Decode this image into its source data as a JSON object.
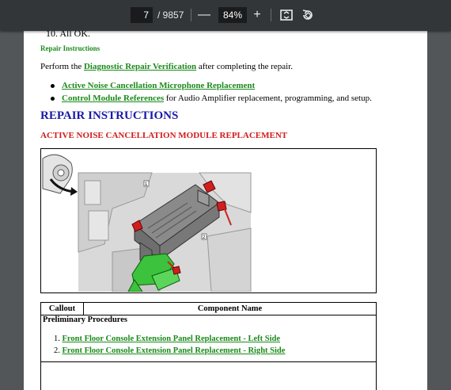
{
  "toolbar": {
    "page_current": "7",
    "page_total": "/ 9857",
    "zoom": "84%",
    "zoom_out": "—",
    "zoom_in": "+"
  },
  "doc": {
    "cut_line": "10. All OK.",
    "repair_heading": "Repair Instructions",
    "perform_pre": "Perform the ",
    "perform_link": "Diagnostic Repair Verification",
    "perform_post": " after completing the repair.",
    "bullets": [
      {
        "link": "Active Noise Cancellation Microphone Replacement",
        "rest": ""
      },
      {
        "link": "Control Module References",
        "rest": " for Audio Amplifier replacement, programming, and setup."
      }
    ],
    "main_heading": "REPAIR INSTRUCTIONS",
    "sub_heading": "ACTIVE NOISE CANCELLATION MODULE REPLACEMENT",
    "figure_callouts": [
      "1",
      "2"
    ],
    "table": {
      "col1": "Callout",
      "col2": "Component Name",
      "prelim": "Preliminary Procedures",
      "steps": [
        {
          "num": "1.",
          "text": "Front Floor Console Extension Panel Replacement - Left Side"
        },
        {
          "num": "2.",
          "text": "Front Floor Console Extension Panel Replacement - Right Side"
        }
      ]
    }
  },
  "colors": {
    "link_green": "#1b8a1b",
    "heading_blue": "#1a1aa8",
    "heading_red": "#d41919",
    "toolbar_bg": "#323639"
  }
}
